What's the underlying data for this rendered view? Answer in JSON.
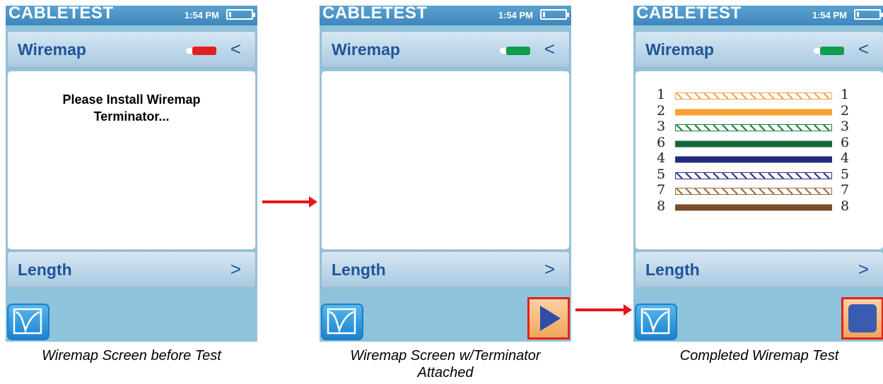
{
  "screens": [
    {
      "status": {
        "app_title": "CABLETEST",
        "time": "1:54 PM"
      },
      "wiremap": {
        "label": "Wiremap",
        "chevron": "<",
        "connector_color": "#e02020"
      },
      "message": [
        "Please Install Wiremap",
        "Terminator..."
      ],
      "length": {
        "label": "Length",
        "chevron": ">"
      },
      "caption": "Wiremap Screen before Test"
    },
    {
      "status": {
        "app_title": "CABLETEST",
        "time": "1:54 PM"
      },
      "wiremap": {
        "label": "Wiremap",
        "chevron": "<",
        "connector_color": "#0e9e4e"
      },
      "length": {
        "label": "Length",
        "chevron": ">"
      },
      "action_button": {
        "icon": "play-icon"
      },
      "caption": [
        "Wiremap Screen w/Terminator",
        "Attached"
      ]
    },
    {
      "status": {
        "app_title": "CABLETEST",
        "time": "1:54 PM"
      },
      "wiremap": {
        "label": "Wiremap",
        "chevron": "<",
        "connector_color": "#0e9e4e"
      },
      "wires": [
        {
          "left": "1",
          "right": "1",
          "color": "#f3a14a",
          "striped": true
        },
        {
          "left": "2",
          "right": "2",
          "color": "#f7a030",
          "striped": false
        },
        {
          "left": "3",
          "right": "3",
          "color": "#177b45",
          "striped": true
        },
        {
          "left": "6",
          "right": "6",
          "color": "#12683b",
          "striped": false
        },
        {
          "left": "4",
          "right": "4",
          "color": "#232a7e",
          "striped": false
        },
        {
          "left": "5",
          "right": "5",
          "color": "#2b3088",
          "striped": true
        },
        {
          "left": "7",
          "right": "7",
          "color": "#9b6a3c",
          "striped": true
        },
        {
          "left": "8",
          "right": "8",
          "color": "#7a4e28",
          "striped": false
        }
      ],
      "length": {
        "label": "Length",
        "chevron": ">"
      },
      "action_button": {
        "icon": "stop-icon"
      },
      "caption": "Completed Wiremap Test"
    }
  ]
}
